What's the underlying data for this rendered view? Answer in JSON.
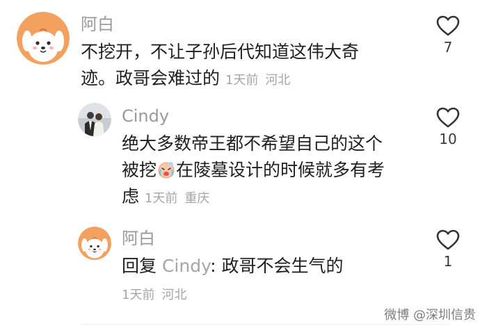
{
  "comments": [
    {
      "author": "阿白",
      "text_line1": "不挖开，不让子孙后代知道这伟大奇",
      "text_line2": "迹。政哥会难过的",
      "time": "1天前",
      "location": "河北",
      "likes": "7",
      "avatar_icon": "cartoon-dog-avatar"
    },
    {
      "author": "Cindy",
      "text_line1": "绝大多数帝王都不希望自己的这个",
      "text_line2a": "被挖",
      "text_line2b": "在陵墓设计的时候就多有考",
      "text_line3": "虑",
      "emoji": "crying-face-emoji",
      "time": "1天前",
      "location": "重庆",
      "likes": "10",
      "avatar_icon": "couple-photo-avatar"
    },
    {
      "author": "阿白",
      "reply_prefix": "回复",
      "reply_target": "Cindy",
      "reply_sep": ":",
      "text": " 政哥不会生气的",
      "time": "1天前",
      "location": "河北",
      "likes": "1",
      "avatar_icon": "cartoon-dog-avatar"
    }
  ],
  "watermark": "微博 @深圳信贵",
  "colors": {
    "text": "#1f1f1f",
    "secondary": "#9a9a9a",
    "avatar_bg": "#f4a15f"
  }
}
